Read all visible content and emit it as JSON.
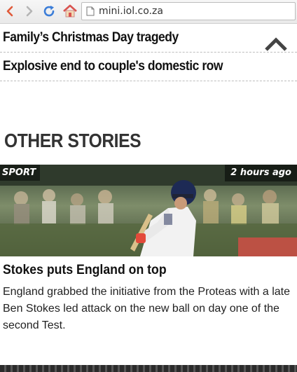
{
  "browser": {
    "url": "mini.iol.co.za",
    "icons": [
      "back-arrow-icon",
      "forward-arrow-icon",
      "reload-icon",
      "home-icon",
      "page-icon"
    ]
  },
  "headlines": [
    {
      "title": "Family’s Christmas Day tragedy"
    },
    {
      "title": "Explosive end to couple's domestic row"
    }
  ],
  "section": {
    "title": "OTHER STORIES"
  },
  "story": {
    "category": "SPORT",
    "time": "2 hours ago",
    "title": "Stokes puts England on top",
    "summary": "England grabbed the initiative from the Proteas with a late Ben Stokes led attack on the new ball on day one of the second Test."
  },
  "colors": {
    "home_roof": "#d9534f",
    "reload": "#3b7dd8",
    "section_text": "#333333"
  }
}
